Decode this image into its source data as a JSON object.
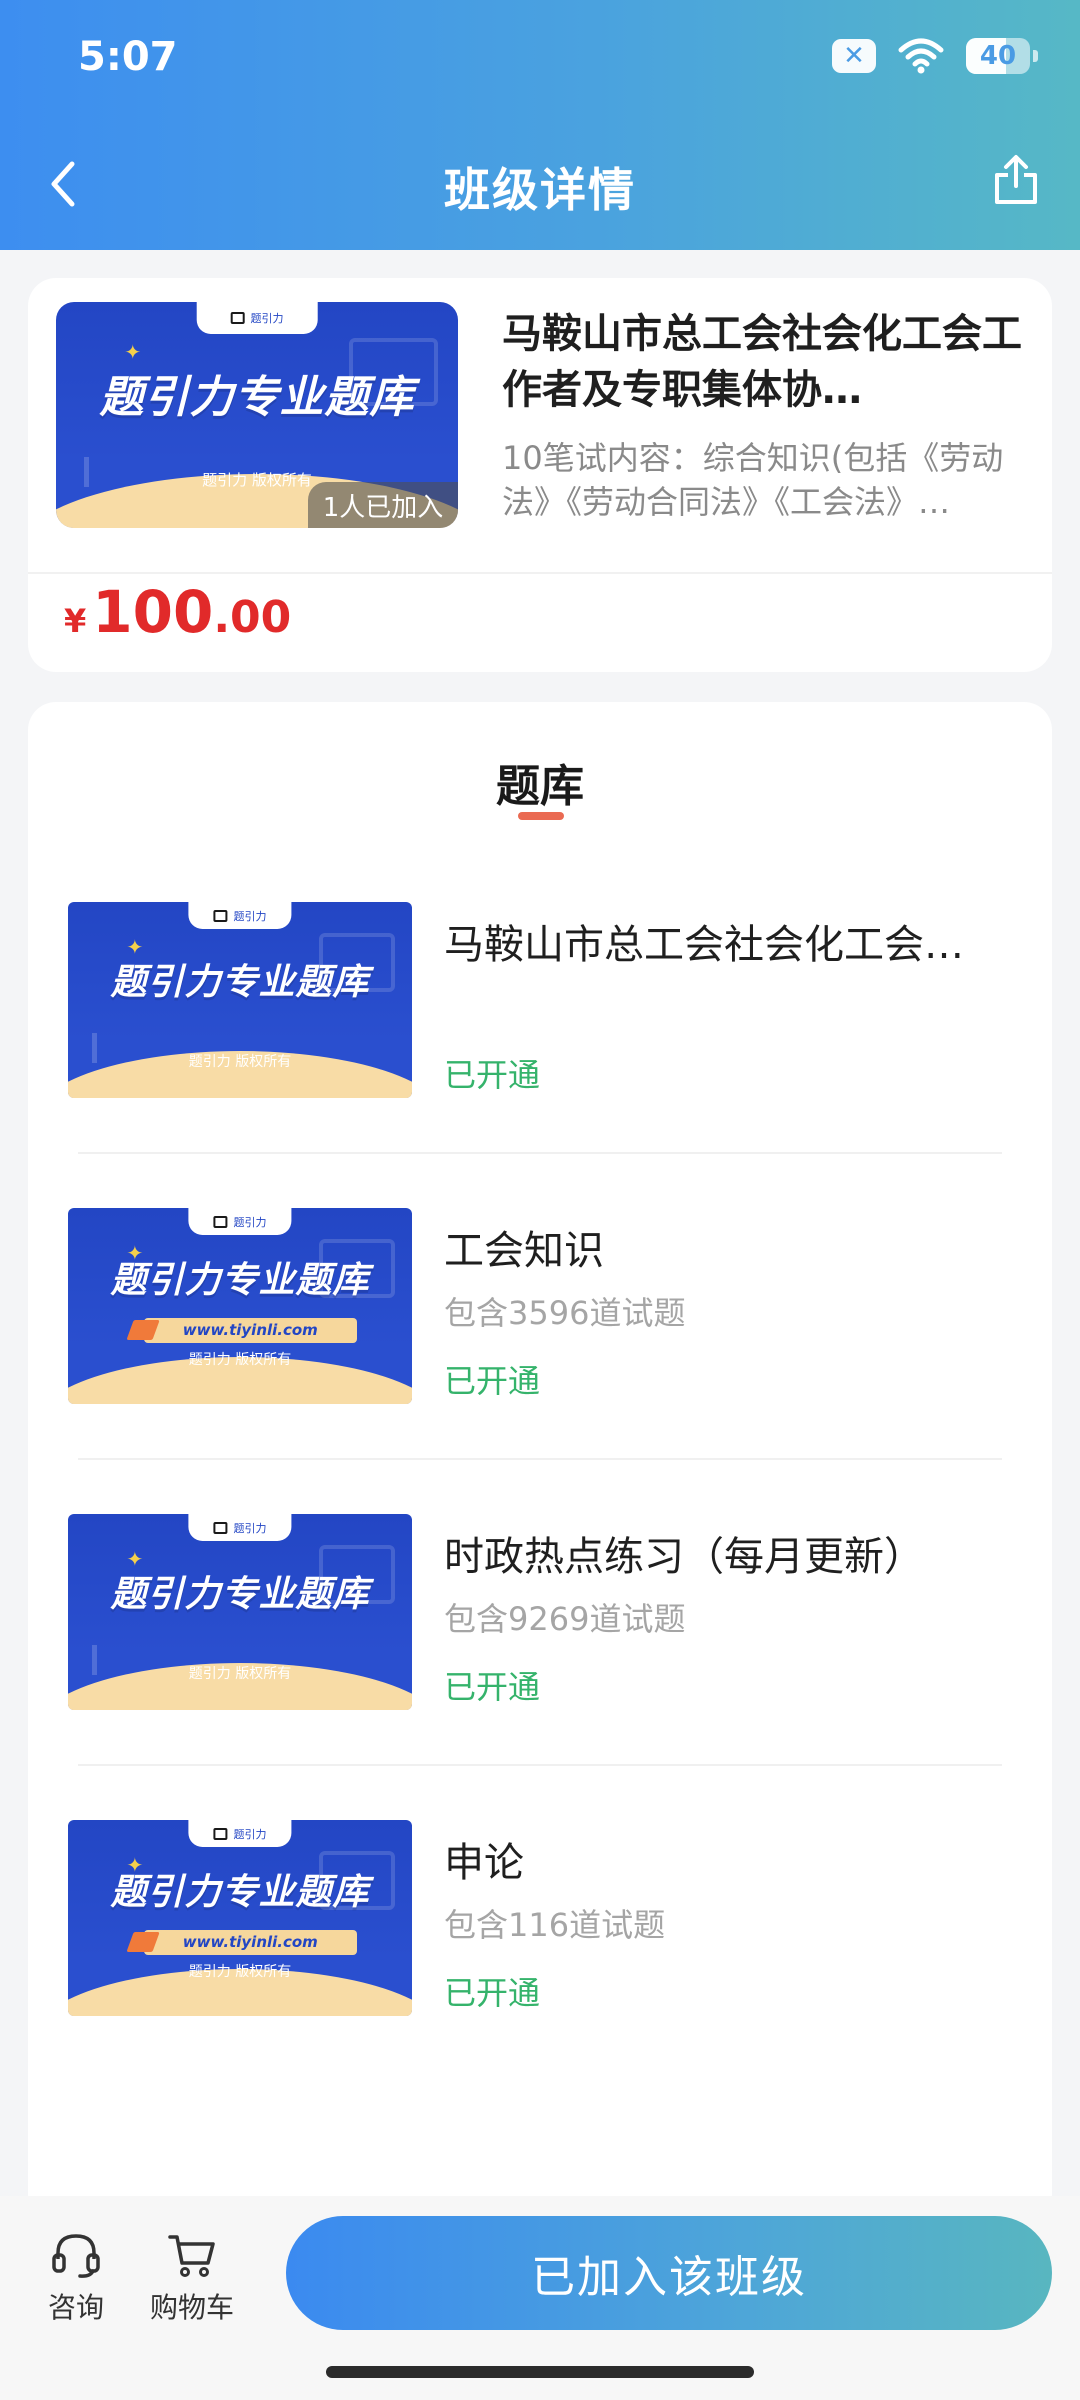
{
  "status_bar": {
    "time": "5:07",
    "battery": "40"
  },
  "nav": {
    "title": "班级详情"
  },
  "class_card": {
    "banner_brand": "题引力",
    "banner_title": "题引力专业题库",
    "banner_copyright": "题引力 版权所有",
    "joined_badge": "1人已加入",
    "title": "马鞍山市总工会社会化工会工作者及专职集体协…",
    "description": "10笔试内容：综合知识(包括《劳动法》《劳动合同法》《工会法》…",
    "price_symbol": "¥",
    "price_integer": "100",
    "price_decimal": ".00"
  },
  "question_bank": {
    "section_title": "题库",
    "items": [
      {
        "name": "马鞍山市总工会社会化工会…",
        "count": "",
        "status": "已开通",
        "banner_title": "题引力专业题库",
        "banner_url": "",
        "banner_copyright": "题引力 版权所有",
        "banner_brand": "题引力"
      },
      {
        "name": "工会知识",
        "count": "包含3596道试题",
        "status": "已开通",
        "banner_title": "题引力专业题库",
        "banner_url": "www.tiyinli.com",
        "banner_copyright": "题引力 版权所有",
        "banner_brand": "题引力"
      },
      {
        "name": "时政热点练习（每月更新）",
        "count": "包含9269道试题",
        "status": "已开通",
        "banner_title": "题引力专业题库",
        "banner_url": "",
        "banner_copyright": "题引力 版权所有",
        "banner_brand": "题引力"
      },
      {
        "name": "申论",
        "count": "包含116道试题",
        "status": "已开通",
        "banner_title": "题引力专业题库",
        "banner_url": "www.tiyinli.com",
        "banner_copyright": "题引力 版权所有",
        "banner_brand": "题引力"
      }
    ]
  },
  "bottom_bar": {
    "consult_label": "咨询",
    "cart_label": "购物车",
    "join_button": "已加入该班级"
  },
  "colors": {
    "header_start": "#3d8ef0",
    "header_end": "#56b8c6",
    "price_red": "#e12a2a",
    "status_green": "#35b36b",
    "underline": "#ea6a52",
    "banner_blue": "#2346c4"
  }
}
